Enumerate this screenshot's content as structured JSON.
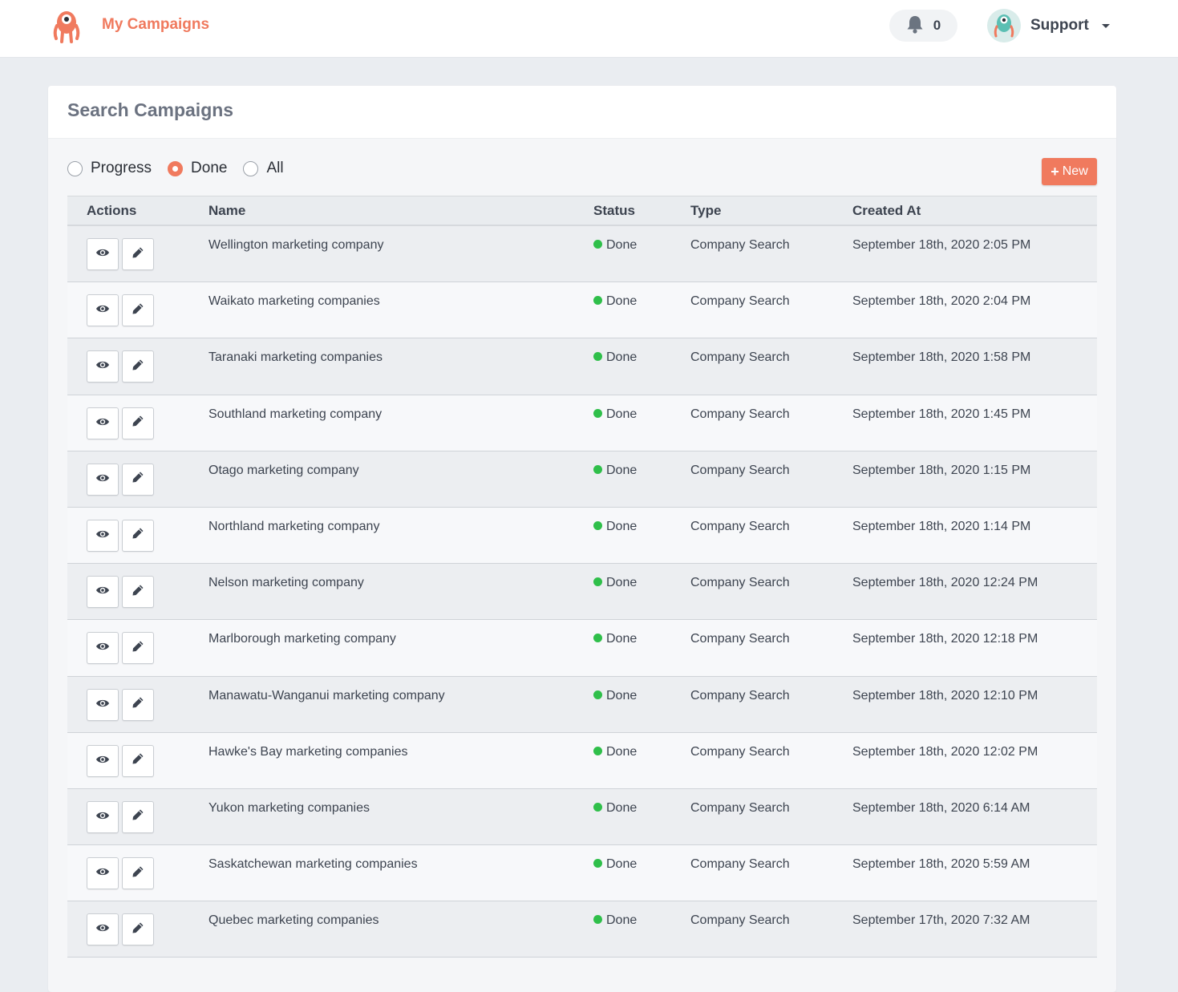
{
  "navbar": {
    "title": "My Campaigns",
    "notification_count": "0",
    "user_name": "Support"
  },
  "card": {
    "title": "Search Campaigns"
  },
  "filters": {
    "options": [
      "Progress",
      "Done",
      "All"
    ],
    "selected": "Done"
  },
  "new_button": {
    "label": "New",
    "icon": "plus-icon"
  },
  "table": {
    "headers": [
      "Actions",
      "Name",
      "Status",
      "Type",
      "Created At"
    ],
    "rows": [
      {
        "name": "Wellington marketing company",
        "status": "Done",
        "type": "Company Search",
        "created": "September 18th, 2020 2:05 PM"
      },
      {
        "name": "Waikato marketing companies",
        "status": "Done",
        "type": "Company Search",
        "created": "September 18th, 2020 2:04 PM"
      },
      {
        "name": "Taranaki marketing companies",
        "status": "Done",
        "type": "Company Search",
        "created": "September 18th, 2020 1:58 PM"
      },
      {
        "name": "Southland marketing company",
        "status": "Done",
        "type": "Company Search",
        "created": "September 18th, 2020 1:45 PM"
      },
      {
        "name": "Otago marketing company",
        "status": "Done",
        "type": "Company Search",
        "created": "September 18th, 2020 1:15 PM"
      },
      {
        "name": "Northland marketing company",
        "status": "Done",
        "type": "Company Search",
        "created": "September 18th, 2020 1:14 PM"
      },
      {
        "name": "Nelson marketing company",
        "status": "Done",
        "type": "Company Search",
        "created": "September 18th, 2020 12:24 PM"
      },
      {
        "name": "Marlborough marketing company",
        "status": "Done",
        "type": "Company Search",
        "created": "September 18th, 2020 12:18 PM"
      },
      {
        "name": "Manawatu-Wanganui marketing company",
        "status": "Done",
        "type": "Company Search",
        "created": "September 18th, 2020 12:10 PM"
      },
      {
        "name": "Hawke's Bay marketing companies",
        "status": "Done",
        "type": "Company Search",
        "created": "September 18th, 2020 12:02 PM"
      },
      {
        "name": "Yukon marketing companies",
        "status": "Done",
        "type": "Company Search",
        "created": "September 18th, 2020 6:14 AM"
      },
      {
        "name": "Saskatchewan marketing companies",
        "status": "Done",
        "type": "Company Search",
        "created": "September 18th, 2020 5:59 AM"
      },
      {
        "name": "Quebec marketing companies",
        "status": "Done",
        "type": "Company Search",
        "created": "September 17th, 2020 7:32 AM"
      }
    ]
  },
  "colors": {
    "accent": "#f07a5e",
    "status_done": "#2fbf4a"
  }
}
